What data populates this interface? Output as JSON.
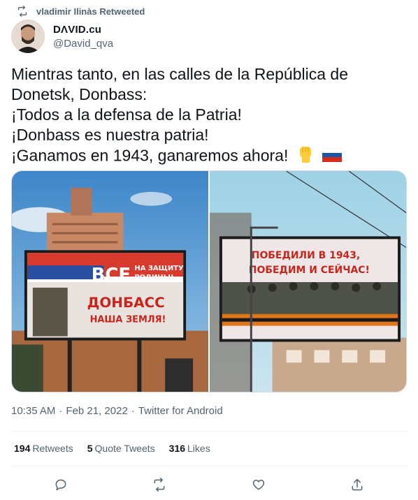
{
  "retweet": {
    "icon": "retweet-icon",
    "text": "vladimir Ilinàs Retweeted"
  },
  "author": {
    "display_name": "DΛVID.cu",
    "handle": "@David_qva"
  },
  "tweet": {
    "lines": [
      "Mientras tanto, en las calles de la República de",
      "Donetsk, Donbass:",
      "¡Todos a la defensa de la Patria!",
      "¡Donbass es nuestra patria!",
      "¡Ganamos en 1943, ganaremos ahora!"
    ],
    "emojis": [
      "raised-fist-emoji",
      "russia-flag-emoji"
    ]
  },
  "media": {
    "photo1": {
      "billboard_line1": "ВСЕ",
      "billboard_line2a": "НА ЗАЩИТУ",
      "billboard_line2b": "РОДИНЫ!",
      "billboard_line3": "ДОНБАСС",
      "billboard_line4": "НАША ЗЕМЛЯ!"
    },
    "photo2": {
      "billboard_line1": "ПОБЕДИЛИ В 1943,",
      "billboard_line2": "ПОБЕДИМ И СЕЙЧАС!"
    }
  },
  "meta": {
    "time": "10:35 AM",
    "date": "Feb 21, 2022",
    "source": "Twitter for Android",
    "separator": "·"
  },
  "stats": {
    "retweets_count": "194",
    "retweets_label": "Retweets",
    "quotes_count": "5",
    "quotes_label": "Quote Tweets",
    "likes_count": "316",
    "likes_label": "Likes"
  },
  "actions": [
    "reply-icon",
    "retweet-icon",
    "like-icon",
    "share-icon"
  ],
  "colors": {
    "text": "#0f1419",
    "secondary": "#536471",
    "divider": "#eff3f4"
  }
}
